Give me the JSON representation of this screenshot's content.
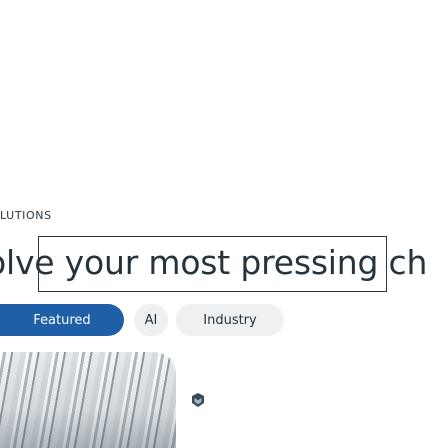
{
  "section": {
    "label": "LUTIONS"
  },
  "headline": {
    "text": "olve your most pressing ch"
  },
  "filters": {
    "items": [
      {
        "label": "Featured",
        "active": true
      },
      {
        "label": "AI",
        "active": false
      },
      {
        "label": "Industry",
        "active": false
      }
    ]
  },
  "card": {
    "thumbnail_icon": "image-thumbnail",
    "badge_icon": "brand-logo-icon"
  },
  "colors": {
    "accent": "#1f5fa8",
    "text": "#25333d",
    "pill_bg": "#eef0f2"
  }
}
